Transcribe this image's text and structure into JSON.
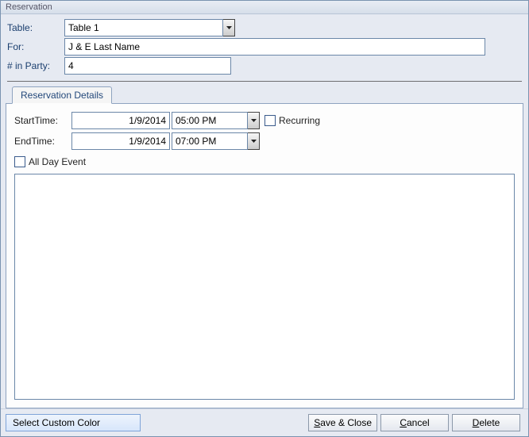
{
  "window": {
    "title": "Reservation"
  },
  "form": {
    "table_label": "Table:",
    "table_value": "Table 1",
    "for_label": "For:",
    "for_value": "J & E Last Name",
    "party_label": "# in Party:",
    "party_value": "4"
  },
  "tab": {
    "label": "Reservation Details"
  },
  "details": {
    "start_label": "StartTime:",
    "start_date": "1/9/2014",
    "start_time": "05:00 PM",
    "end_label": "EndTime:",
    "end_date": "1/9/2014",
    "end_time": "07:00 PM",
    "recurring_label": "Recurring",
    "recurring_checked": false,
    "allday_label": "All Day Event",
    "allday_checked": false,
    "notes": ""
  },
  "footer": {
    "color": "Select Custom Color",
    "save": "ave & Close",
    "save_key": "S",
    "cancel": "ancel",
    "cancel_key": "C",
    "delete": "elete",
    "delete_key": "D"
  }
}
